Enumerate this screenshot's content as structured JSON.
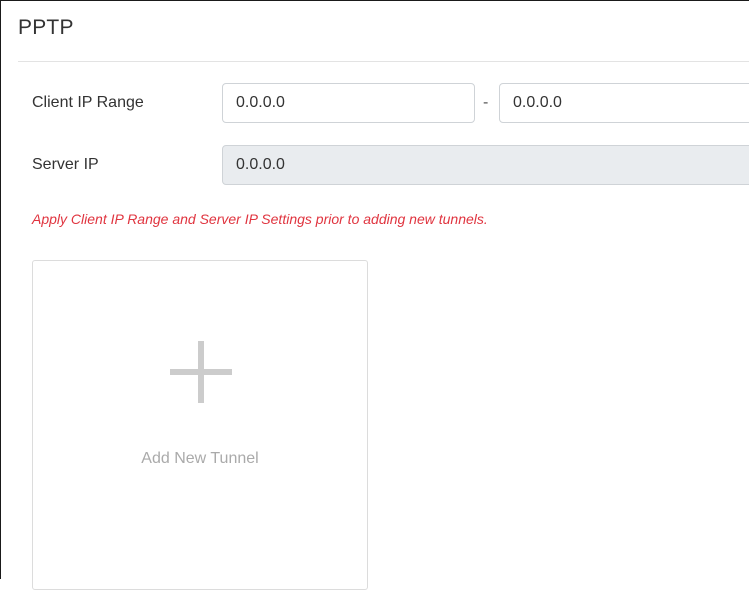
{
  "section": {
    "title": "PPTP"
  },
  "form": {
    "client_ip_range": {
      "label": "Client IP Range",
      "start_value": "0.0.0.0",
      "separator": "-",
      "end_value": "0.0.0.0"
    },
    "server_ip": {
      "label": "Server IP",
      "value": "0.0.0.0"
    },
    "warning": "Apply Client IP Range and Server IP Settings prior to adding new tunnels."
  },
  "tunnels": {
    "add_label": "Add New Tunnel",
    "add_icon": "plus-icon"
  },
  "colors": {
    "warning": "#e0343f",
    "disabled_input_bg": "#e9ecef",
    "placeholder_gray": "#aaaaaa"
  }
}
